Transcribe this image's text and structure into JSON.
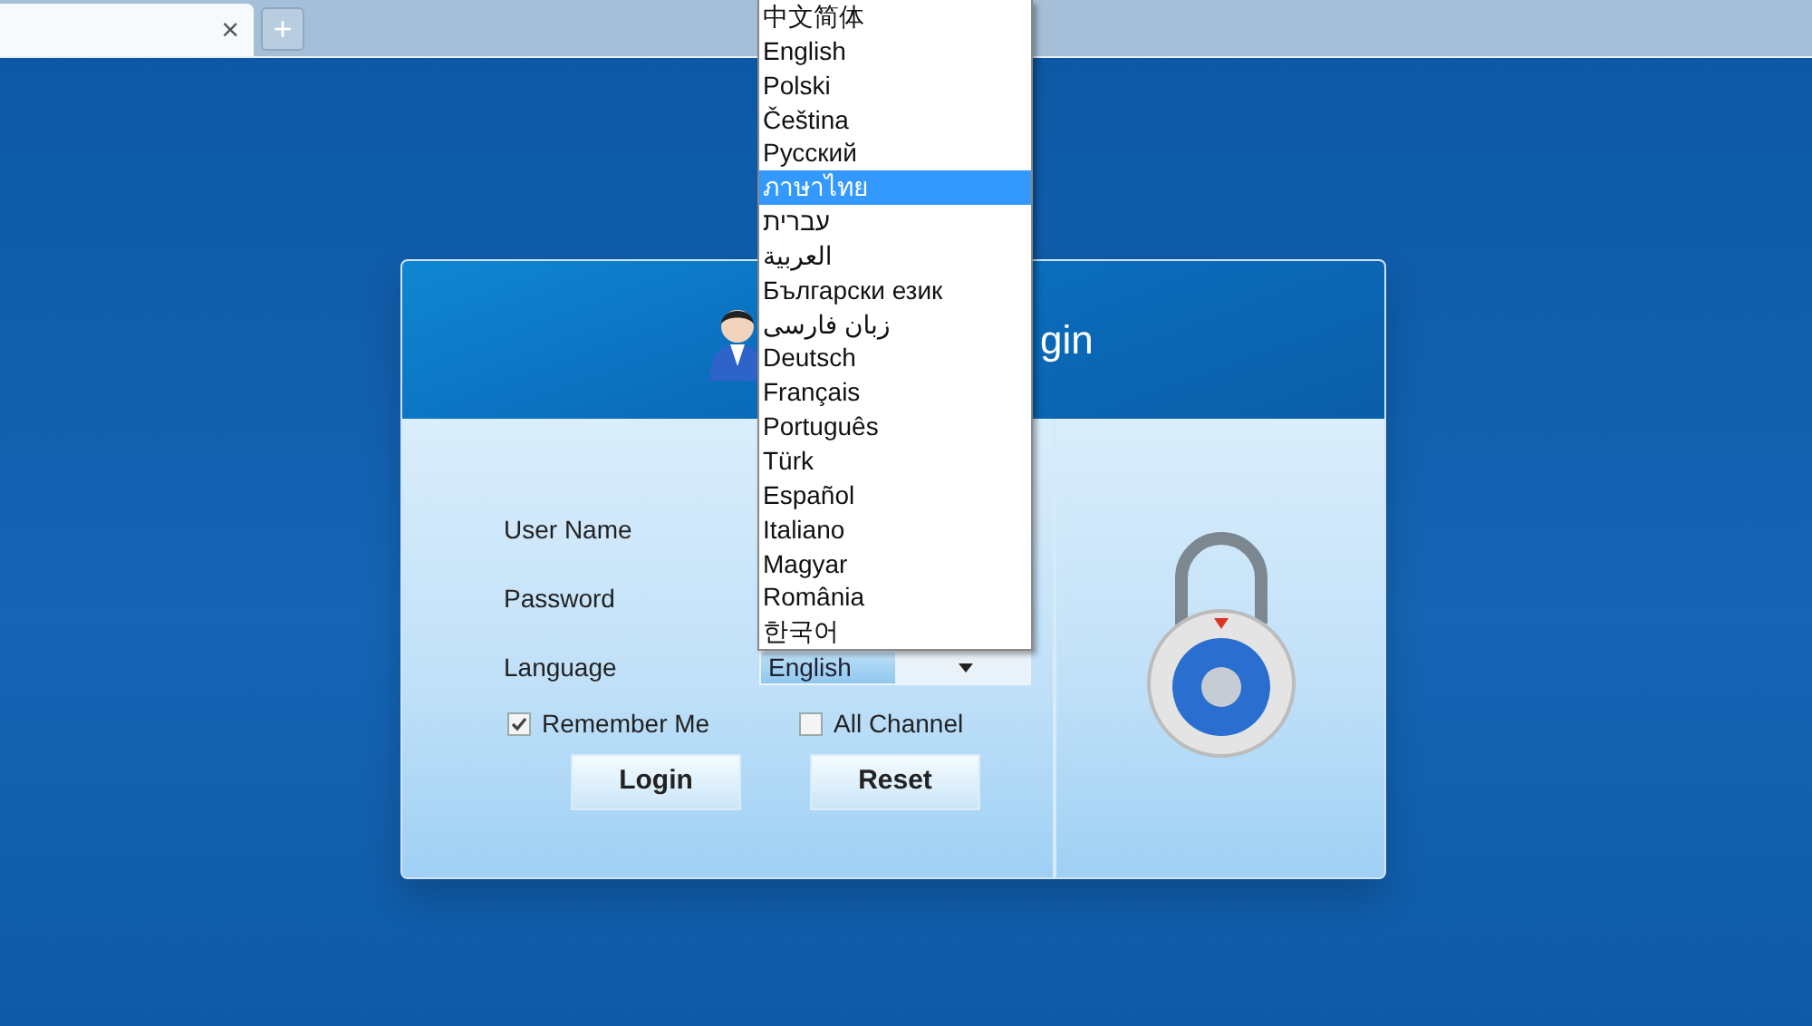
{
  "browser_tab": {
    "close": "×",
    "new_tab": "+"
  },
  "login": {
    "title": "gin",
    "fields": [
      {
        "label": "User Name",
        "kind": "text"
      },
      {
        "label": "Password",
        "kind": "text"
      },
      {
        "label": "Language",
        "kind": "select",
        "value": "English"
      }
    ],
    "language_options": [
      {
        "label": "中文简体",
        "selected": false
      },
      {
        "label": "English",
        "selected": false
      },
      {
        "label": "Polski",
        "selected": false
      },
      {
        "label": "Čeština",
        "selected": false
      },
      {
        "label": "Русский",
        "selected": false
      },
      {
        "label": "ภาษาไทย",
        "selected": true
      },
      {
        "label": "עברית",
        "selected": false
      },
      {
        "label": "العربية",
        "selected": false
      },
      {
        "label": "Български език",
        "selected": false
      },
      {
        "label": "زبان فارسی",
        "selected": false
      },
      {
        "label": "Deutsch",
        "selected": false
      },
      {
        "label": "Français",
        "selected": false
      },
      {
        "label": "Português",
        "selected": false
      },
      {
        "label": "Türk",
        "selected": false
      },
      {
        "label": "Español",
        "selected": false
      },
      {
        "label": "Italiano",
        "selected": false
      },
      {
        "label": "Magyar",
        "selected": false
      },
      {
        "label": "România",
        "selected": false
      },
      {
        "label": "한국어",
        "selected": false
      }
    ],
    "checkboxes": [
      {
        "label": "Remember Me",
        "checked": true
      },
      {
        "label": "All Channel",
        "checked": false
      }
    ],
    "buttons": [
      "Login",
      "Reset"
    ]
  }
}
